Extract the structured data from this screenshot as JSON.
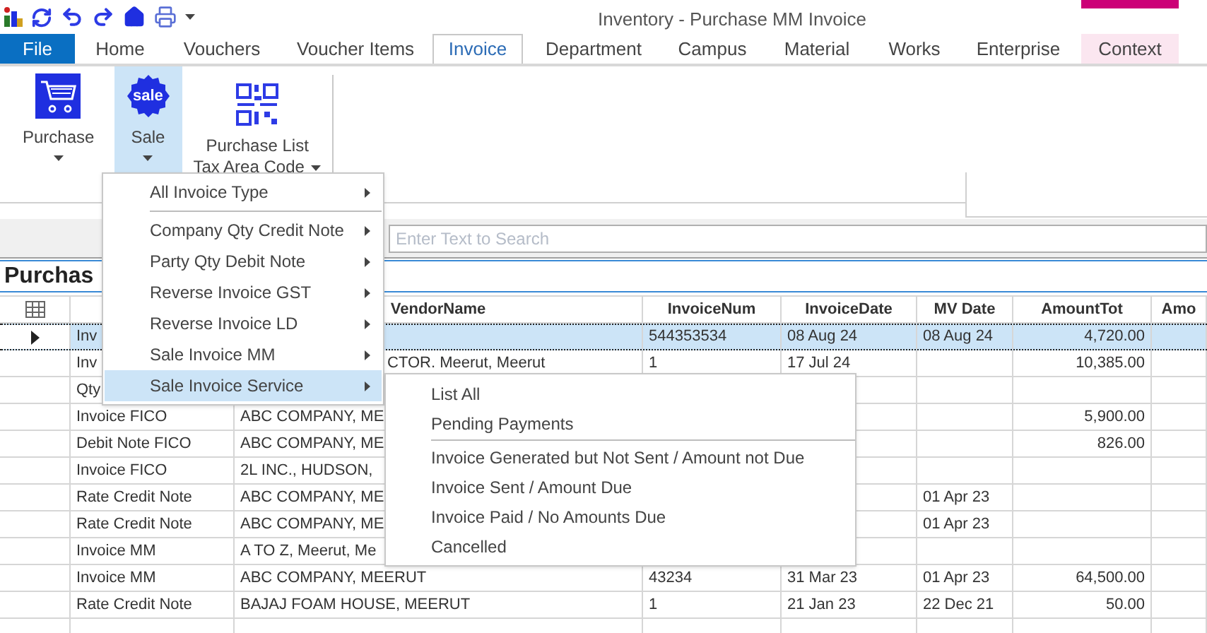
{
  "window": {
    "title": "Inventory - Purchase MM Invoice"
  },
  "ribbon_tabs": [
    {
      "label": "File",
      "kind": "file",
      "selected": false
    },
    {
      "label": "Home",
      "kind": "tab",
      "selected": false
    },
    {
      "label": "Vouchers",
      "kind": "tab",
      "selected": false
    },
    {
      "label": "Voucher Items",
      "kind": "tab",
      "selected": false
    },
    {
      "label": "Invoice",
      "kind": "tab",
      "selected": true
    },
    {
      "label": "Department",
      "kind": "tab",
      "selected": false
    },
    {
      "label": "Campus",
      "kind": "tab",
      "selected": false
    },
    {
      "label": "Material",
      "kind": "tab",
      "selected": false
    },
    {
      "label": "Works",
      "kind": "tab",
      "selected": false
    },
    {
      "label": "Enterprise",
      "kind": "tab",
      "selected": false
    },
    {
      "label": "Context",
      "kind": "context",
      "selected": false
    }
  ],
  "ribbon_buttons": [
    {
      "kind": "cart",
      "lines": [
        "Purchase"
      ],
      "selected": false
    },
    {
      "kind": "sale",
      "badge_text": "sale",
      "lines": [
        "Sale"
      ],
      "selected": true
    },
    {
      "kind": "qr",
      "lines": [
        "Purchase List",
        "Tax Area Code"
      ],
      "selected": false
    }
  ],
  "search": {
    "placeholder": "Enter Text to Search"
  },
  "grid": {
    "title": "Purchas",
    "columns": [
      "VendorName",
      "InvoiceNum",
      "InvoiceDate",
      "MV Date",
      "AmountTot",
      "Amo"
    ],
    "rows": [
      {
        "selected": true,
        "type": "Inv",
        "invoice_num": "544353534",
        "invoice_date": "08 Aug 24",
        "mv_date": "08 Aug 24",
        "amount_tot": "4,720.00"
      },
      {
        "selected": false,
        "type": "Inv",
        "vendor_tail": "CTOR. Meerut, Meerut",
        "invoice_num": "1",
        "invoice_date": "17 Jul 24",
        "amount_tot": "10,385.00"
      },
      {
        "selected": false,
        "type": "Qty"
      },
      {
        "selected": false,
        "type": "Invoice FICO",
        "vendor": "ABC COMPANY, ME",
        "amount_tot": "5,900.00"
      },
      {
        "selected": false,
        "type": "Debit Note FICO",
        "vendor": "ABC COMPANY, ME",
        "amount_tot": "826.00"
      },
      {
        "selected": false,
        "type": "Invoice FICO",
        "vendor": "2L INC., HUDSON,"
      },
      {
        "selected": false,
        "type": "Rate Credit Note",
        "vendor": "ABC COMPANY, ME",
        "mv_date": "01 Apr 23"
      },
      {
        "selected": false,
        "type": "Rate Credit Note",
        "vendor": "ABC COMPANY, ME",
        "mv_date": "01 Apr 23"
      },
      {
        "selected": false,
        "type": "Invoice MM",
        "vendor": "A TO Z, Meerut, Me"
      },
      {
        "selected": false,
        "type": "Invoice MM",
        "vendor": "ABC COMPANY, MEERUT",
        "invoice_num": "43234",
        "invoice_date": "31 Mar 23",
        "mv_date": "01 Apr 23",
        "amount_tot": "64,500.00"
      },
      {
        "selected": false,
        "type": "Rate Credit Note",
        "vendor": "BAJAJ FOAM HOUSE, MEERUT",
        "invoice_num": "1",
        "invoice_date": "21 Jan 23",
        "mv_date": "22 Dec 21",
        "amount_tot": "50.00"
      }
    ]
  },
  "menu": {
    "items": [
      {
        "label": "All Invoice Type",
        "selected": false,
        "separator_after": true
      },
      {
        "label": "Company Qty Credit Note",
        "selected": false,
        "separator_after": false
      },
      {
        "label": "Party Qty Debit Note",
        "selected": false,
        "separator_after": false
      },
      {
        "label": "Reverse Invoice GST",
        "selected": false,
        "separator_after": false
      },
      {
        "label": "Reverse Invoice LD",
        "selected": false,
        "separator_after": false
      },
      {
        "label": "Sale Invoice MM",
        "selected": false,
        "separator_after": false
      },
      {
        "label": "Sale Invoice Service",
        "selected": true,
        "separator_after": false
      }
    ]
  },
  "submenu": {
    "items": [
      {
        "label": "List All",
        "separator_after": false
      },
      {
        "label": "Pending Payments",
        "separator_after": true
      },
      {
        "label": "Invoice Generated but Not Sent / Amount not Due",
        "separator_after": false
      },
      {
        "label": "Invoice Sent / Amount Due",
        "separator_after": false
      },
      {
        "label": "Invoice Paid / No Amounts Due",
        "separator_after": false
      },
      {
        "label": "Cancelled",
        "separator_after": false
      }
    ]
  }
}
